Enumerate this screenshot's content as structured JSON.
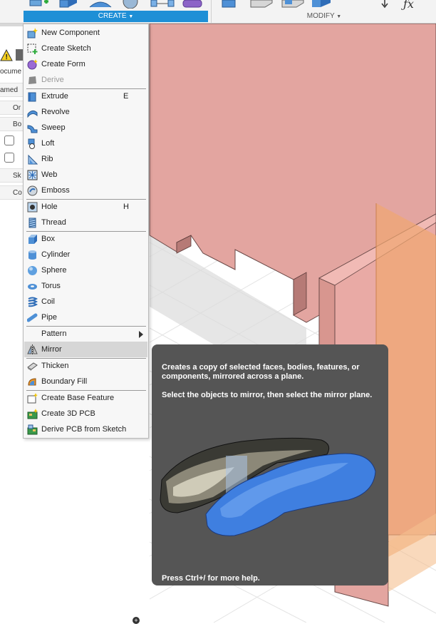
{
  "toolbar": {
    "create_label": "CREATE",
    "modify_label": "MODIFY",
    "fx_label": "ƒx"
  },
  "browser": {
    "rows": [
      "ocume",
      "amed",
      "Or",
      "Bo",
      "Sk",
      "Co"
    ]
  },
  "menu": {
    "items": [
      {
        "label": "New Component",
        "icon": "new-component-icon"
      },
      {
        "label": "Create Sketch",
        "icon": "create-sketch-icon"
      },
      {
        "label": "Create Form",
        "icon": "create-form-icon"
      },
      {
        "label": "Derive",
        "icon": "derive-icon",
        "disabled": true
      },
      {
        "label": "Extrude",
        "shortcut": "E",
        "icon": "extrude-icon"
      },
      {
        "label": "Revolve",
        "icon": "revolve-icon"
      },
      {
        "label": "Sweep",
        "icon": "sweep-icon"
      },
      {
        "label": "Loft",
        "icon": "loft-icon"
      },
      {
        "label": "Rib",
        "icon": "rib-icon"
      },
      {
        "label": "Web",
        "icon": "web-icon"
      },
      {
        "label": "Emboss",
        "icon": "emboss-icon"
      },
      {
        "label": "Hole",
        "shortcut": "H",
        "icon": "hole-icon"
      },
      {
        "label": "Thread",
        "icon": "thread-icon"
      },
      {
        "label": "Box",
        "icon": "box-icon"
      },
      {
        "label": "Cylinder",
        "icon": "cylinder-icon"
      },
      {
        "label": "Sphere",
        "icon": "sphere-icon"
      },
      {
        "label": "Torus",
        "icon": "torus-icon"
      },
      {
        "label": "Coil",
        "icon": "coil-icon"
      },
      {
        "label": "Pipe",
        "icon": "pipe-icon"
      },
      {
        "label": "Pattern",
        "icon": "",
        "submenu": true
      },
      {
        "label": "Mirror",
        "icon": "mirror-icon",
        "highlighted": true
      },
      {
        "label": "Thicken",
        "icon": "thicken-icon"
      },
      {
        "label": "Boundary Fill",
        "icon": "boundary-fill-icon"
      },
      {
        "label": "Create Base Feature",
        "icon": "create-base-feature-icon"
      },
      {
        "label": "Create 3D PCB",
        "icon": "create-3d-pcb-icon"
      },
      {
        "label": "Derive PCB from Sketch",
        "icon": "derive-pcb-icon"
      }
    ]
  },
  "tooltip": {
    "description": "Creates a copy of selected faces, bodies, features, or components, mirrored across a plane.",
    "instruction": "Select the objects to mirror, then select the mirror plane.",
    "help": "Press Ctrl+/ for more help."
  },
  "colors": {
    "accent": "#1e8fd6",
    "body_fill": "#e8a8a3",
    "tooltip_bg": "#555555",
    "menu_highlight": "#d6d6d6"
  }
}
